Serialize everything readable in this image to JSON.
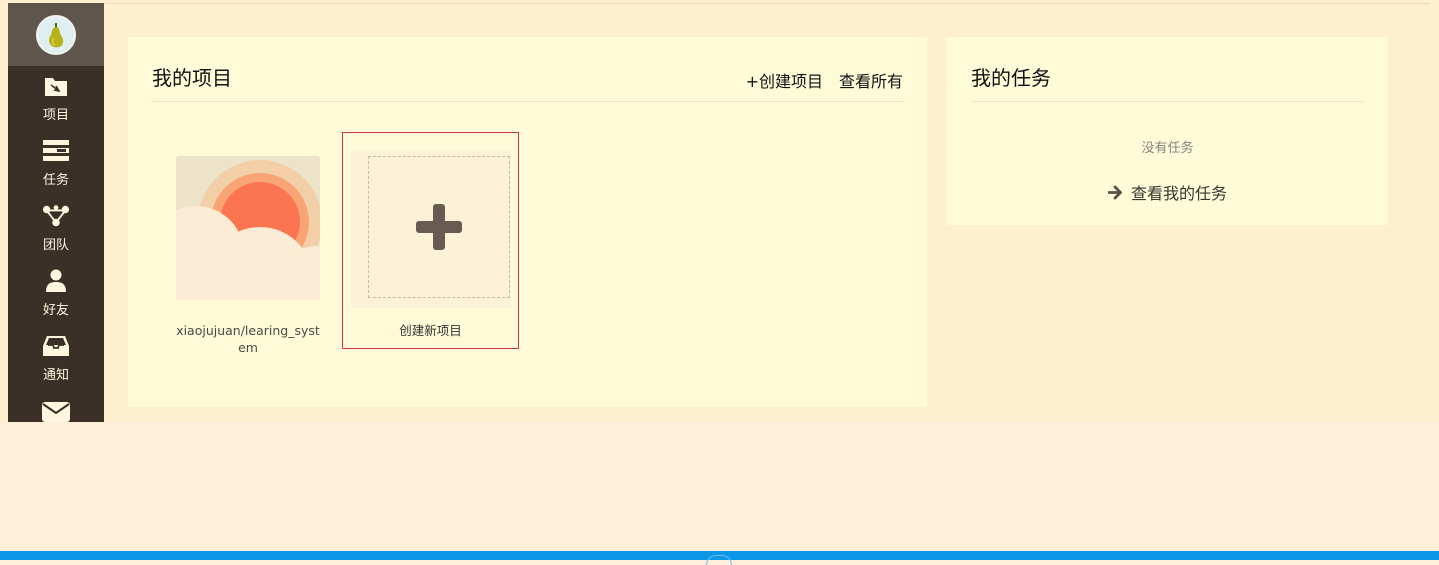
{
  "sidebar": {
    "items": [
      {
        "label": "项目",
        "icon": "folder-icon"
      },
      {
        "label": "任务",
        "icon": "tasks-icon"
      },
      {
        "label": "团队",
        "icon": "team-icon"
      },
      {
        "label": "好友",
        "icon": "user-icon"
      },
      {
        "label": "通知",
        "icon": "inbox-icon"
      },
      {
        "label": "",
        "icon": "envelope-icon"
      }
    ]
  },
  "projects": {
    "title": "我的项目",
    "create_link": "+创建项目",
    "view_all_link": "查看所有",
    "items": [
      {
        "name": "xiaojujuan/learing_system"
      }
    ],
    "create_card_label": "创建新项目"
  },
  "tasks": {
    "title": "我的任务",
    "empty_text": "没有任务",
    "view_link": "查看我的任务"
  },
  "colors": {
    "sidebar_bg": "#3a3028",
    "panel_bg": "#fffad8",
    "page_bg": "#fef0ce",
    "highlight_border": "#d4324a",
    "bottom_bar": "#0c98e6"
  }
}
